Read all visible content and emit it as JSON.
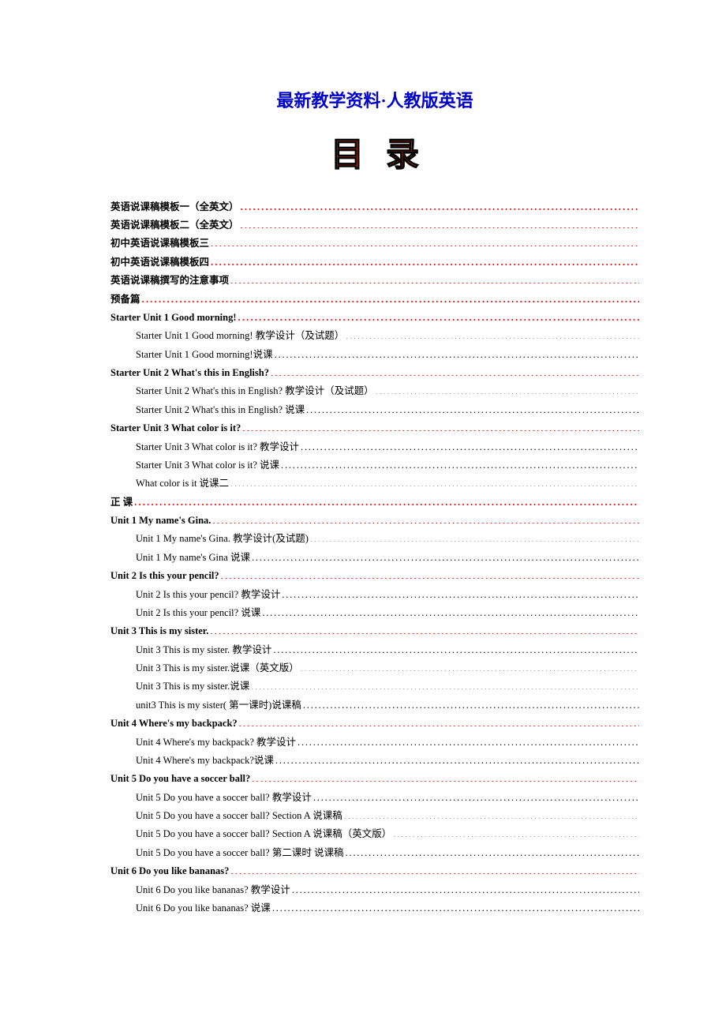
{
  "header": {
    "title": "最新教学资料·人教版英语",
    "toc_label_chars": [
      "目",
      "录"
    ]
  },
  "toc": [
    {
      "level": 1,
      "bold": true,
      "leader": "red",
      "label": "英语说课稿模板一（全英文）"
    },
    {
      "level": 1,
      "bold": true,
      "leader": "red",
      "label": "英语说课稿模板二（全英文）"
    },
    {
      "level": 1,
      "bold": true,
      "leader": "red",
      "label": "初中英语说课稿模板三"
    },
    {
      "level": 1,
      "bold": true,
      "leader": "red",
      "label": "初中英语说课稿模板四"
    },
    {
      "level": 1,
      "bold": true,
      "leader": "red",
      "label": "英语说课稿撰写的注意事项"
    },
    {
      "level": 1,
      "bold": true,
      "leader": "red",
      "label": "预备篇"
    },
    {
      "level": 1,
      "bold": true,
      "leader": "red",
      "label": "Starter Unit 1 Good morning!"
    },
    {
      "level": 2,
      "bold": false,
      "leader": "black",
      "label": "Starter Unit 1 Good morning!   教学设计（及试题）"
    },
    {
      "level": 2,
      "bold": false,
      "leader": "black",
      "label": "Starter Unit 1 Good morning!说课"
    },
    {
      "level": 1,
      "bold": true,
      "leader": "red",
      "label": "Starter Unit 2 What's this in English?"
    },
    {
      "level": 2,
      "bold": false,
      "leader": "black",
      "label": "Starter Unit 2 What's this in English?  教学设计（及试题）"
    },
    {
      "level": 2,
      "bold": false,
      "leader": "black",
      "label": "Starter Unit 2 What's this in English?  说课"
    },
    {
      "level": 1,
      "bold": true,
      "leader": "red",
      "label": "Starter Unit 3 What color is it?"
    },
    {
      "level": 2,
      "bold": false,
      "leader": "black",
      "label": "Starter Unit 3 What color is it?  教学设计"
    },
    {
      "level": 2,
      "bold": false,
      "leader": "black",
      "label": "Starter Unit 3 What color is it?  说课"
    },
    {
      "level": 2,
      "bold": false,
      "leader": "black",
      "label": "What color is it  说课二"
    },
    {
      "level": 1,
      "bold": true,
      "leader": "red",
      "label": "正 课"
    },
    {
      "level": 1,
      "bold": true,
      "leader": "red",
      "label": "Unit 1 My name's Gina."
    },
    {
      "level": 2,
      "bold": false,
      "leader": "black",
      "label": "Unit 1 My name's Gina.  教学设计(及试题)"
    },
    {
      "level": 2,
      "bold": false,
      "leader": "black",
      "label": "Unit 1 My name's Gina  说课"
    },
    {
      "level": 1,
      "bold": true,
      "leader": "red",
      "label": "Unit 2 Is this your pencil?"
    },
    {
      "level": 2,
      "bold": false,
      "leader": "black",
      "label": "Unit 2 Is this your pencil?  教学设计"
    },
    {
      "level": 2,
      "bold": false,
      "leader": "black",
      "label": "Unit 2 Is this your pencil?  说课"
    },
    {
      "level": 1,
      "bold": true,
      "leader": "red",
      "label": "Unit 3 This is my sister."
    },
    {
      "level": 2,
      "bold": false,
      "leader": "black",
      "label": "Unit 3 This is my sister.  教学设计"
    },
    {
      "level": 2,
      "bold": false,
      "leader": "black",
      "label": "Unit 3 This is my sister.说课（英文版）"
    },
    {
      "level": 2,
      "bold": false,
      "leader": "black",
      "label": "Unit 3 This is my sister.说课"
    },
    {
      "level": 2,
      "bold": false,
      "leader": "black",
      "label": "unit3 This is my sister(  第一课时)说课稿"
    },
    {
      "level": 1,
      "bold": true,
      "leader": "red",
      "label": "Unit 4 Where's my backpack?"
    },
    {
      "level": 2,
      "bold": false,
      "leader": "black",
      "label": "Unit 4 Where's my backpack?  教学设计"
    },
    {
      "level": 2,
      "bold": false,
      "leader": "black",
      "label": "Unit 4 Where's my backpack?说课"
    },
    {
      "level": 1,
      "bold": true,
      "leader": "red",
      "label": "Unit 5 Do you have a soccer ball?"
    },
    {
      "level": 2,
      "bold": false,
      "leader": "black",
      "label": "Unit 5 Do you have a soccer ball?  教学设计"
    },
    {
      "level": 2,
      "bold": false,
      "leader": "black",
      "label": "Unit 5 Do you have a soccer ball? Section A    说课稿"
    },
    {
      "level": 2,
      "bold": false,
      "leader": "black",
      "label": "Unit 5 Do you have a soccer ball? Section A    说课稿（英文版）"
    },
    {
      "level": 2,
      "bold": false,
      "leader": "black",
      "label": "Unit 5 Do you have a soccer ball?  第二课时    说课稿"
    },
    {
      "level": 1,
      "bold": true,
      "leader": "red",
      "label": "Unit 6 Do you like bananas?"
    },
    {
      "level": 2,
      "bold": false,
      "leader": "black",
      "label": "Unit 6 Do you like bananas?  教学设计"
    },
    {
      "level": 2,
      "bold": false,
      "leader": "black",
      "label": "Unit 6 Do you like bananas?  说课"
    }
  ]
}
